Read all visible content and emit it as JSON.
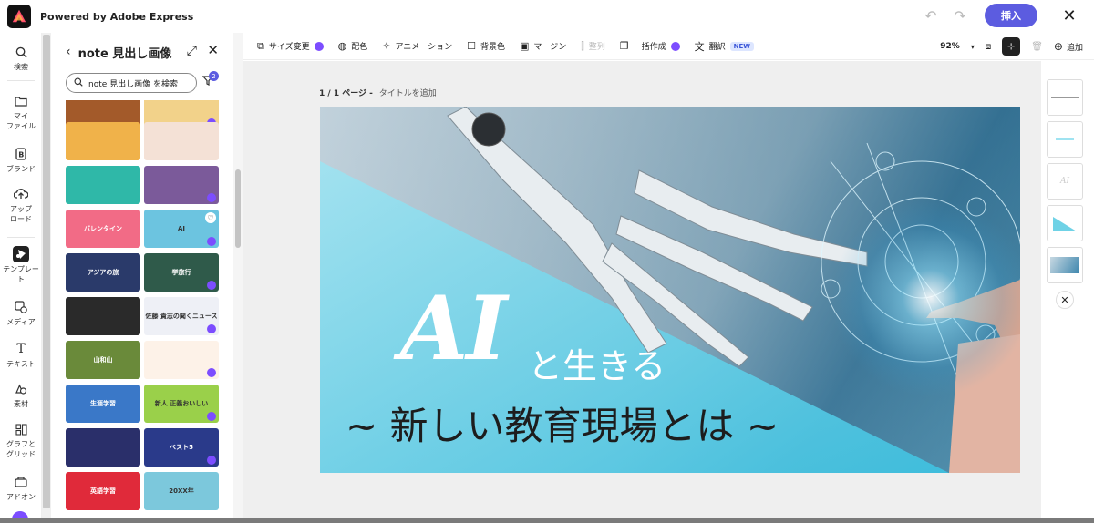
{
  "header": {
    "brand": "Powered by Adobe Express",
    "insert_label": "挿入"
  },
  "rail": {
    "items": [
      {
        "label": "検索",
        "icon": "search-icon"
      },
      {
        "label": "マイ\nファイル",
        "icon": "folder-icon"
      },
      {
        "label": "ブランド",
        "icon": "brand-icon"
      },
      {
        "label": "アップ\nロード",
        "icon": "upload-icon"
      },
      {
        "label": "テンプレー\nト",
        "icon": "templates-icon"
      },
      {
        "label": "メディア",
        "icon": "media-icon"
      },
      {
        "label": "テキスト",
        "icon": "text-icon"
      },
      {
        "label": "素材",
        "icon": "elements-icon"
      },
      {
        "label": "グラフと\nグリッド",
        "icon": "grid-icon"
      },
      {
        "label": "アドオン",
        "icon": "addons-icon"
      }
    ]
  },
  "panel": {
    "title": "note 見出し画像",
    "search_value": "note 見出し画像 を検索",
    "filter_count": "2",
    "thumbnails": [
      {
        "text": "",
        "color": "#a35a2a"
      },
      {
        "text": "",
        "color": "#f2d28a"
      },
      {
        "text": "",
        "color": "#f0b24a"
      },
      {
        "text": "",
        "color": "#f4e1d6"
      },
      {
        "text": "",
        "color": "#2fb8a8"
      },
      {
        "text": "",
        "color": "#7b5a9a"
      },
      {
        "text": "バレンタイン",
        "color": "#f26b86"
      },
      {
        "text": "AI",
        "color": "#6cc4e0"
      },
      {
        "text": "アジアの旅",
        "color": "#2a3a6a"
      },
      {
        "text": "学旅行",
        "color": "#2f5a4a"
      },
      {
        "text": "",
        "color": "#2a2a2a"
      },
      {
        "text": "佐藤 貴志の聞くニュース",
        "color": "#eef0f6"
      },
      {
        "text": "山和山",
        "color": "#6a8a3a"
      },
      {
        "text": "",
        "color": "#fdf2e8"
      },
      {
        "text": "生涯学習",
        "color": "#3a78c8"
      },
      {
        "text": "新人 正義おいしい",
        "color": "#9ad04a"
      },
      {
        "text": "",
        "color": "#2a2f6a"
      },
      {
        "text": "ベスト5",
        "color": "#2a3a8a"
      },
      {
        "text": "英語学習",
        "color": "#e02a3a"
      },
      {
        "text": "20XX年",
        "color": "#7cc8dc"
      }
    ]
  },
  "toolbar": {
    "items": [
      {
        "label": "サイズ変更",
        "icon": "resize-icon",
        "premium": true
      },
      {
        "label": "配色",
        "icon": "palette-icon"
      },
      {
        "label": "アニメーション",
        "icon": "animation-icon"
      },
      {
        "label": "背景色",
        "icon": "background-icon"
      },
      {
        "label": "マージン",
        "icon": "margin-icon"
      },
      {
        "label": "整列",
        "icon": "align-icon",
        "disabled": true
      },
      {
        "label": "一括作成",
        "icon": "bulk-create-icon",
        "premium": true
      },
      {
        "label": "翻訳",
        "icon": "translate-icon",
        "badge": "NEW"
      }
    ],
    "zoom": "92%",
    "add_label": "追加"
  },
  "canvas": {
    "page_label": "1 / 1 ページ -",
    "add_title": "タイトルを追加",
    "ai_text": "AI",
    "live_text": "と生きる",
    "sub_text": "~ 新しい教育現場とは ~"
  },
  "colors": {
    "accent": "#5c5ce0",
    "premium": "#7c4dff"
  }
}
